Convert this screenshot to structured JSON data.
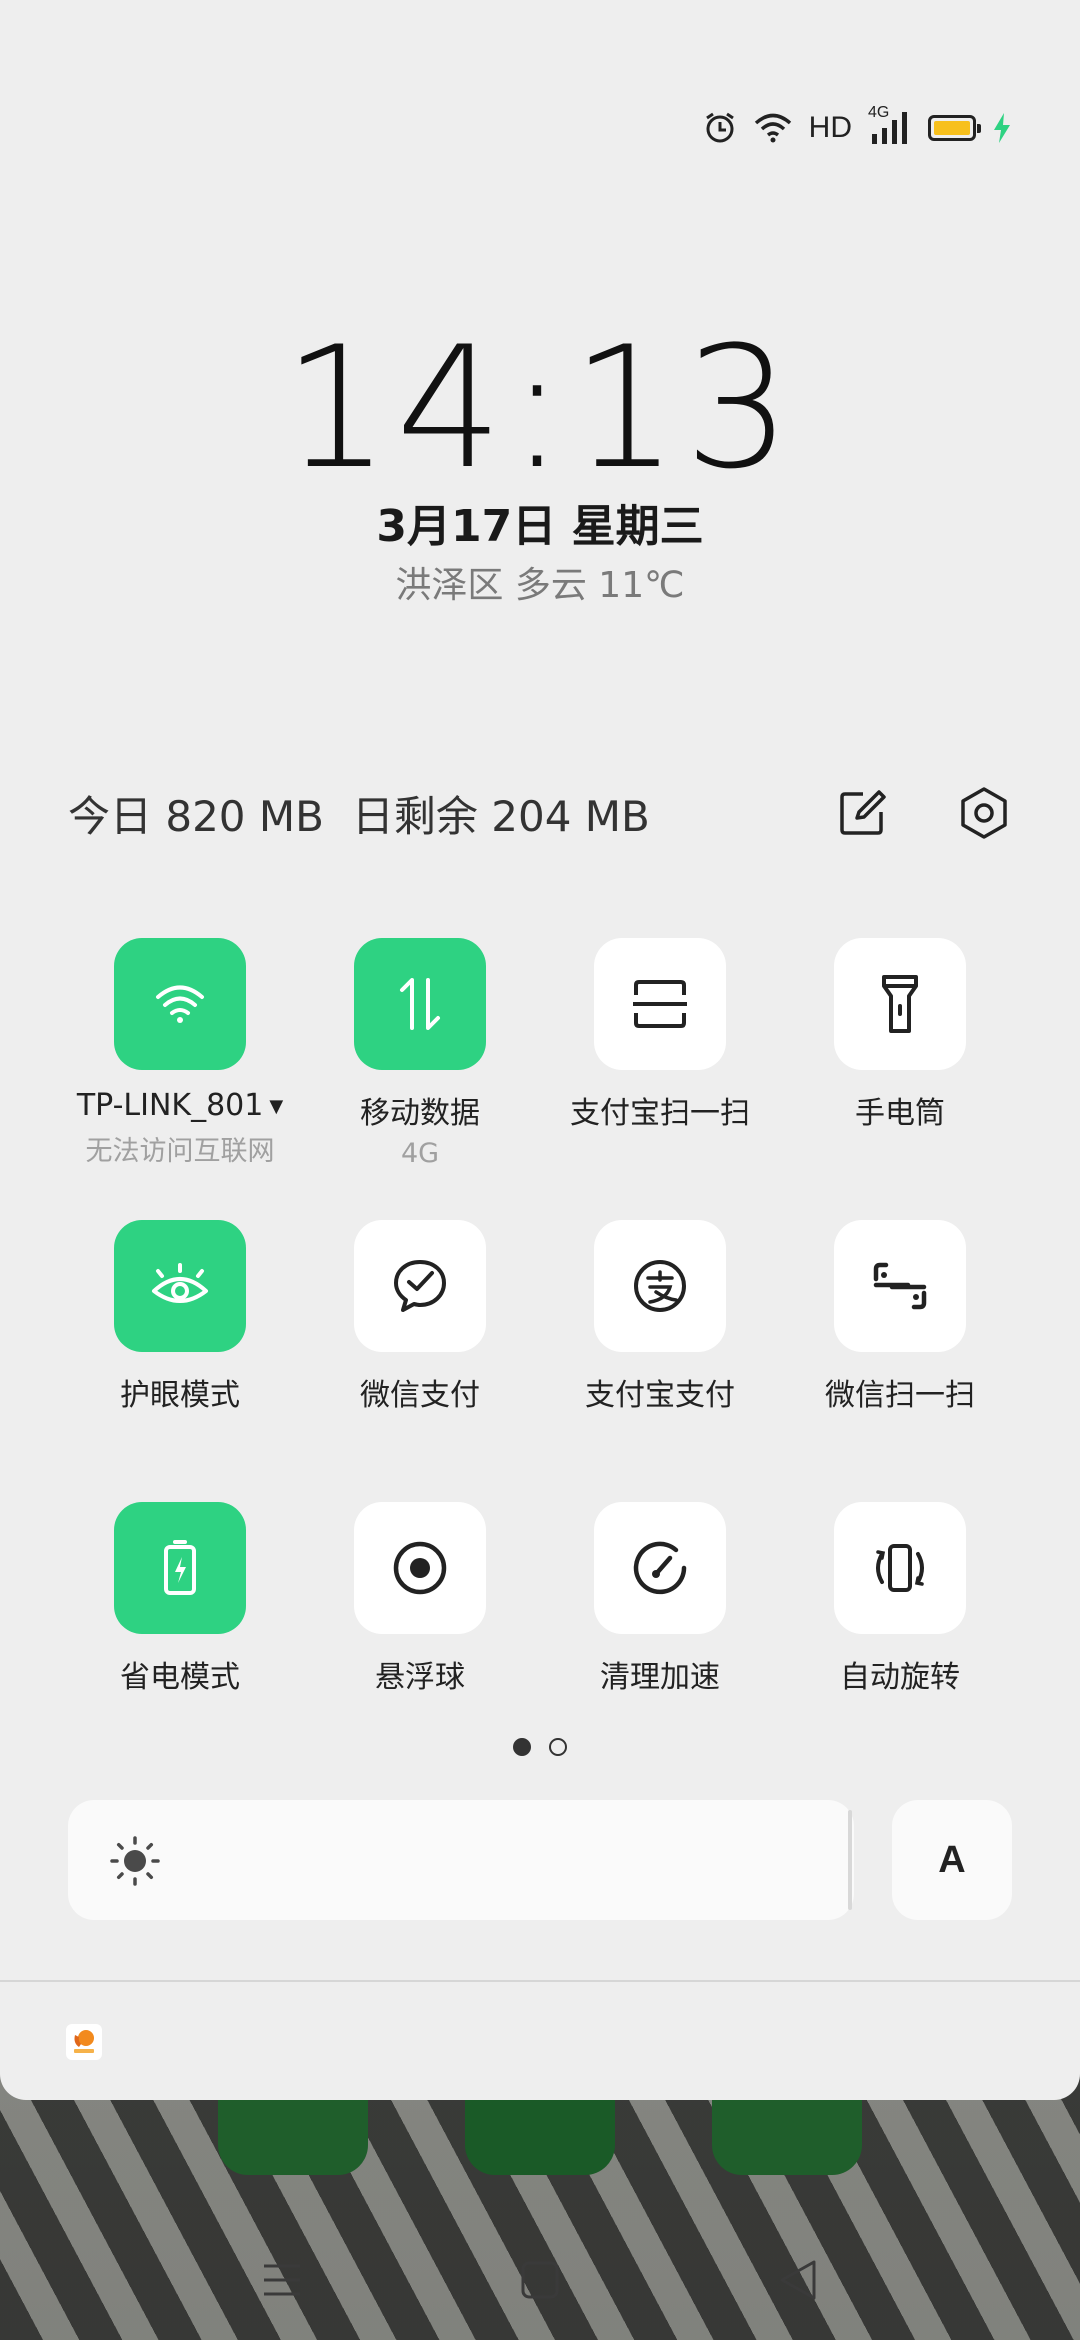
{
  "status_bar": {
    "network_label": "HD",
    "signal_type": "4G",
    "icons": [
      "alarm-icon",
      "wifi-icon",
      "signal-icon",
      "battery-icon",
      "charging-icon"
    ],
    "battery_color": "#f7c01d",
    "charging_color": "#2ed282"
  },
  "lock": {
    "time": "14:13",
    "date": "3月17日  星期三",
    "weather": "洪泽区 多云 11℃"
  },
  "usage": {
    "today": "今日 820 MB",
    "remaining": "日剩余 204 MB",
    "edit_icon": "edit-icon",
    "settings_icon": "settings-icon"
  },
  "tiles": [
    {
      "label": "TP-LINK_801",
      "sub": "无法访问互联网",
      "on": true,
      "icon": "wifi-icon",
      "has_caret": true
    },
    {
      "label": "移动数据",
      "sub": "4G",
      "on": true,
      "icon": "mobile-data-icon"
    },
    {
      "label": "支付宝扫一扫",
      "on": false,
      "icon": "scan-icon"
    },
    {
      "label": "手电筒",
      "on": false,
      "icon": "flashlight-icon"
    },
    {
      "label": "护眼模式",
      "on": true,
      "icon": "eye-icon"
    },
    {
      "label": "微信支付",
      "on": false,
      "icon": "wechat-pay-icon"
    },
    {
      "label": "支付宝支付",
      "on": false,
      "icon": "alipay-icon"
    },
    {
      "label": "微信扫一扫",
      "on": false,
      "icon": "wechat-scan-icon"
    },
    {
      "label": "省电模式",
      "on": true,
      "icon": "battery-saver-icon"
    },
    {
      "label": "悬浮球",
      "on": false,
      "icon": "floating-ball-icon"
    },
    {
      "label": "清理加速",
      "on": false,
      "icon": "speed-clean-icon"
    },
    {
      "label": "自动旋转",
      "on": false,
      "icon": "auto-rotate-icon"
    }
  ],
  "pager": {
    "pages": 2,
    "current": 1
  },
  "brightness": {
    "auto_label": "A",
    "level": 1.0
  },
  "colors": {
    "accent": "#2ed282",
    "panel": "#eeeeee",
    "tile": "#ffffff"
  }
}
